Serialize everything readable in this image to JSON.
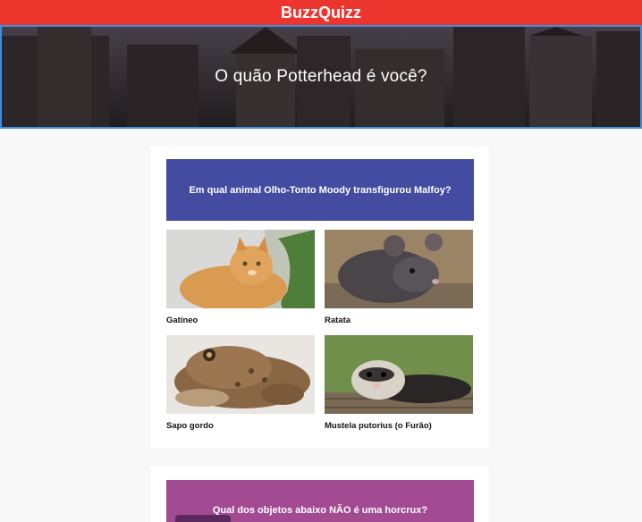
{
  "app": {
    "title": "BuzzQuizz"
  },
  "banner": {
    "title": "O quão Potterhead é você?"
  },
  "questions": [
    {
      "text": "Em qual animal Olho-Tonto Moody transfigurou Malfoy?",
      "color": "#434ca0",
      "options": [
        {
          "label": "Gatíneo",
          "image": "orange-kitten"
        },
        {
          "label": "Ratata",
          "image": "gray-rat"
        },
        {
          "label": "Sapo gordo",
          "image": "brown-toad"
        },
        {
          "label": "Mustela putorius (o Furão)",
          "image": "ferret"
        }
      ]
    },
    {
      "text": "Qual dos objetos abaixo NÃO é uma horcrux?",
      "color": "#a24b93",
      "options": []
    }
  ],
  "colors": {
    "accent": "#ec362d",
    "banner_border": "#3d8fe0"
  }
}
